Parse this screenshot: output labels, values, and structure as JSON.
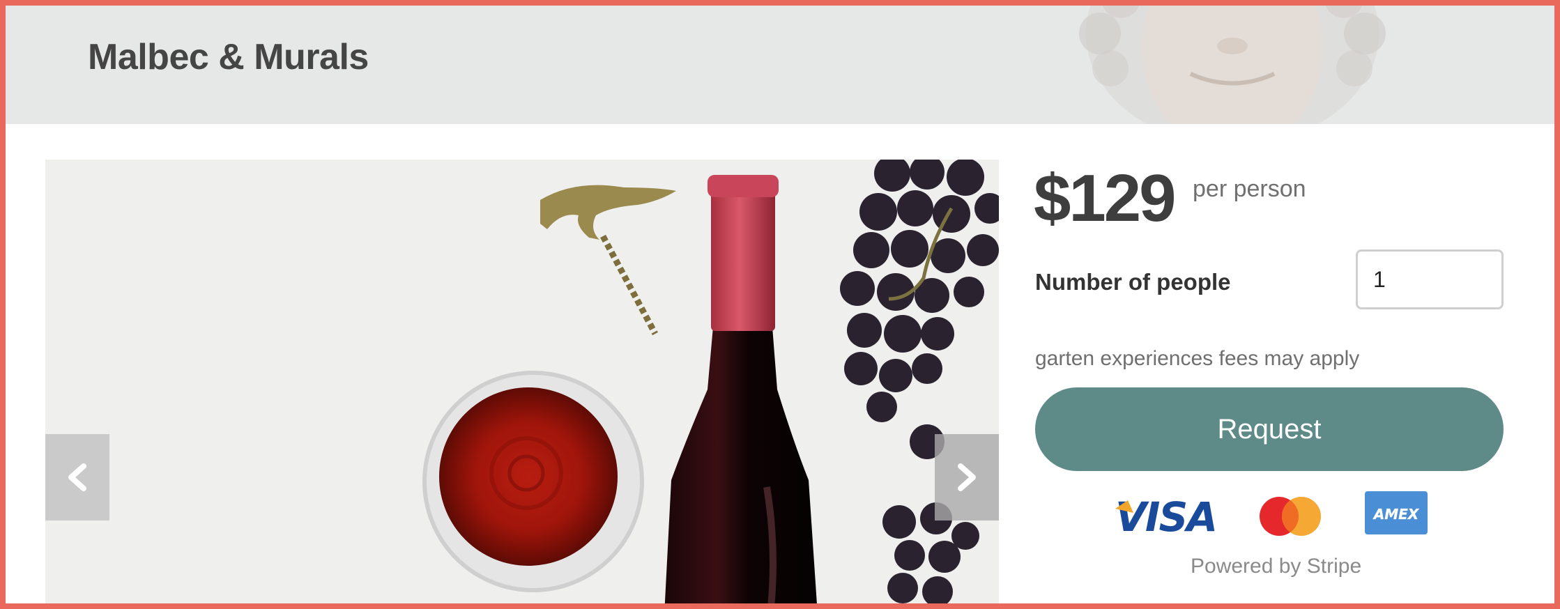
{
  "header": {
    "title": "Malbec & Murals"
  },
  "carousel": {
    "prev_icon": "chevron-left-icon",
    "next_icon": "chevron-right-icon"
  },
  "booking": {
    "price": "$129",
    "price_unit": "per person",
    "people_label": "Number of people",
    "people_value": "1",
    "fees_note": "garten experiences fees may apply",
    "request_label": "Request",
    "payment_icons": [
      "visa-icon",
      "mastercard-icon",
      "amex-icon"
    ],
    "powered_by": "Powered by Stripe"
  },
  "colors": {
    "frame_border": "#e9695d",
    "header_bg": "#e6e7e7",
    "button_bg": "#5e8a87"
  }
}
